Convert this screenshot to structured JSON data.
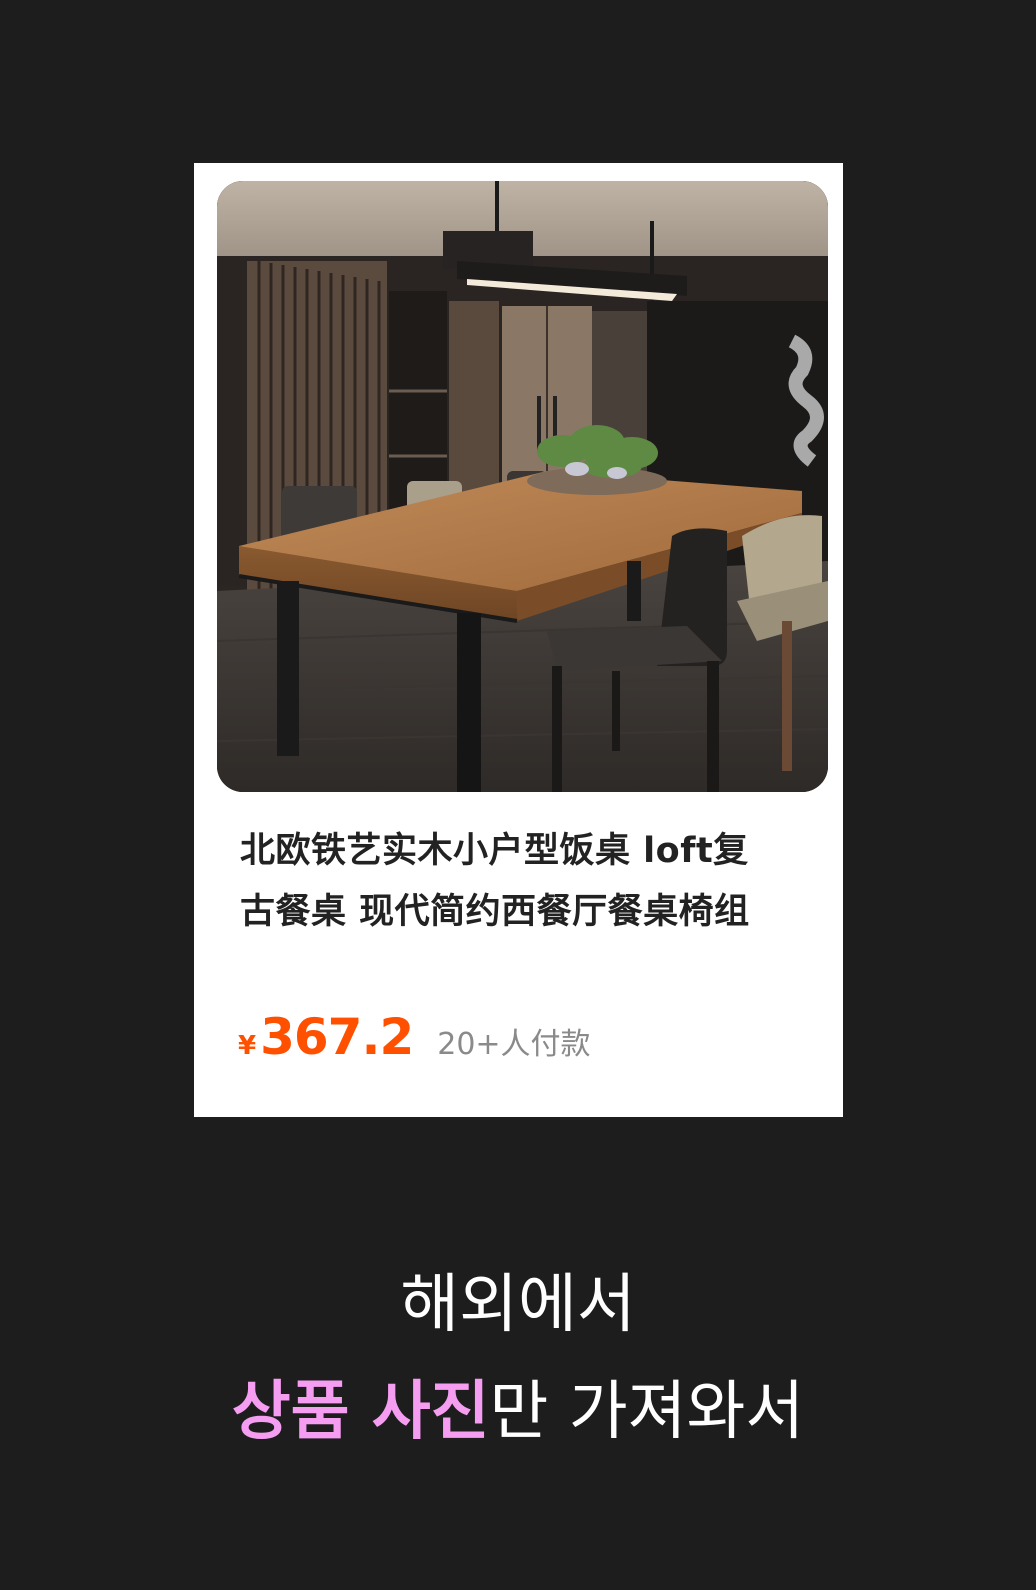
{
  "product": {
    "image_alt": "dining table product photo",
    "title_line1": "北欧铁艺实木小户型饭桌 loft复",
    "title_line2": "古餐桌 现代简约西餐厅餐桌椅组",
    "currency": "¥",
    "price": "367.2",
    "buyers": "20+人付款"
  },
  "caption": {
    "line1": "해외에서",
    "highlight": "상품 사진",
    "rest": "만 가져와서"
  },
  "colors": {
    "background": "#1d1d1d",
    "price": "#ff5000",
    "highlight": "#f59df1"
  }
}
